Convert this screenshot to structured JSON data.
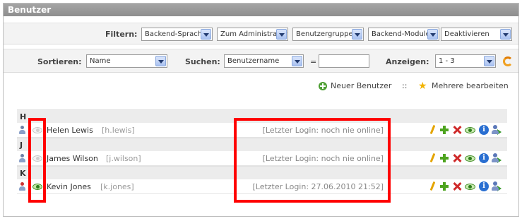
{
  "panel": {
    "title": "Benutzer"
  },
  "filter": {
    "label": "Filtern:",
    "selects": [
      "Backend-Sprache",
      "Zum Administrator",
      "Benutzergruppe",
      "Backend-Module",
      "Deaktivieren"
    ]
  },
  "sort": {
    "label": "Sortieren:",
    "select": "Name",
    "search_label": "Suchen:",
    "search_select": "Benutzername",
    "eq": "=",
    "search_value": "",
    "show_label": "Anzeigen:",
    "show_select": "1 - 3"
  },
  "actions": {
    "new_user": "Neuer Benutzer",
    "separator": "::",
    "edit_multiple": "Mehrere bearbeiten"
  },
  "groups": [
    {
      "letter": "H",
      "user": {
        "name": "Helen Lewis",
        "username": "[h.lewis]",
        "login": "[Letzter Login: noch nie online]",
        "active": false
      }
    },
    {
      "letter": "J",
      "user": {
        "name": "James Wilson",
        "username": "[j.wilson]",
        "login": "[Letzter Login: noch nie online]",
        "active": false
      }
    },
    {
      "letter": "K",
      "user": {
        "name": "Kevin Jones",
        "username": "[k.jones]",
        "login": "[Letzter Login: 27.06.2010 21:52]",
        "active": true
      }
    }
  ],
  "colors": {
    "highlight": "#ff0000",
    "header": "#9a9a9a"
  },
  "icons": [
    "user-icon",
    "eye-icon",
    "edit-icon",
    "copy-icon",
    "delete-icon",
    "show-icon",
    "info-icon",
    "switch-user-icon",
    "add-icon",
    "star-icon",
    "refresh-icon"
  ]
}
